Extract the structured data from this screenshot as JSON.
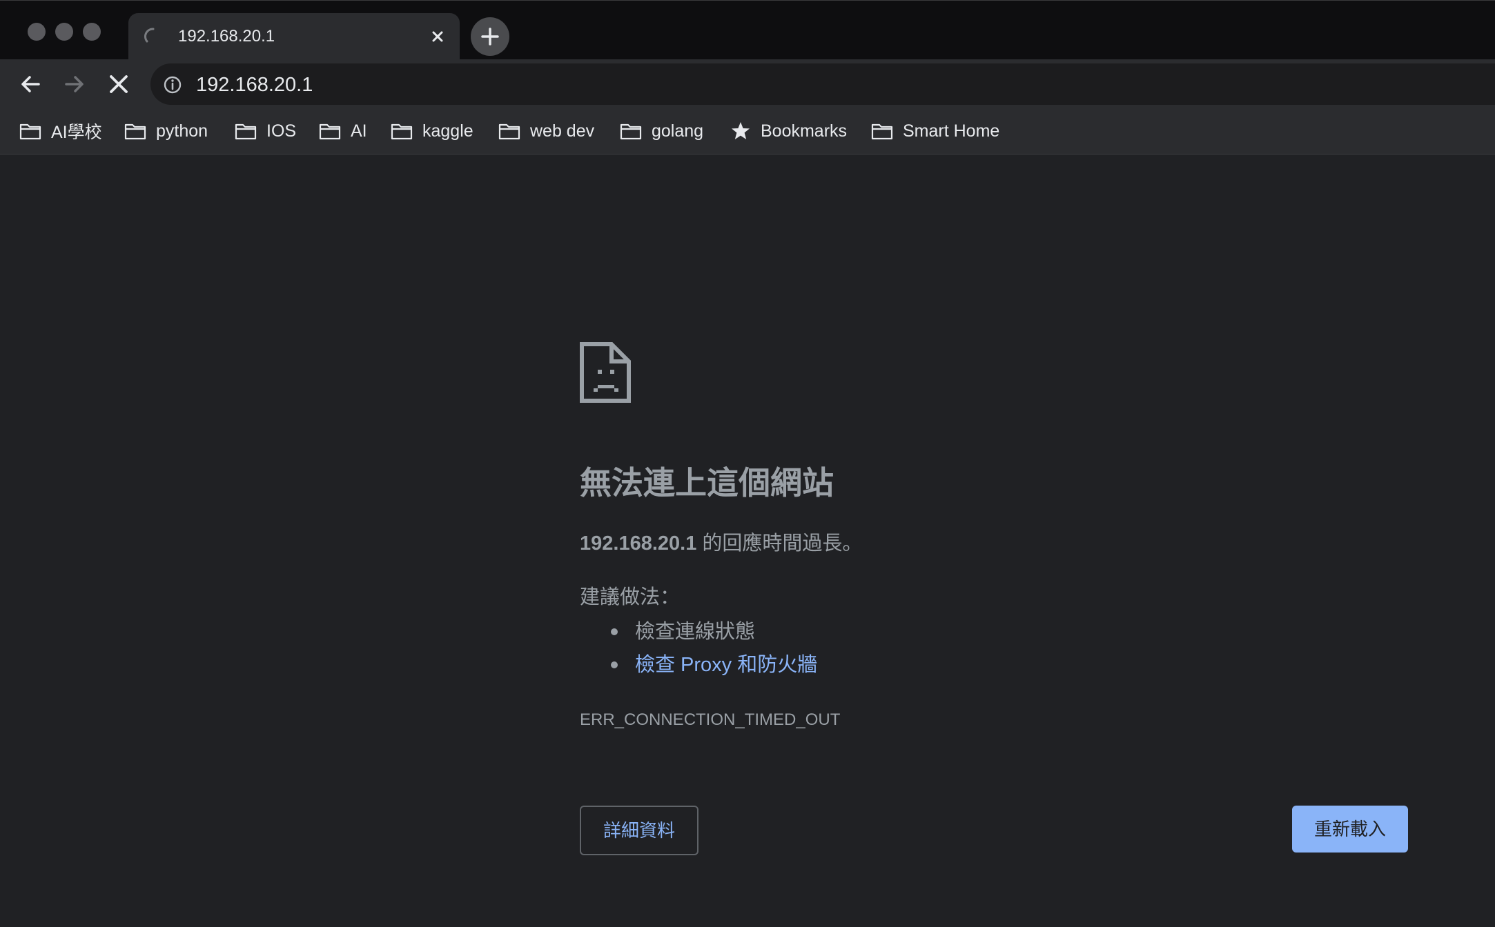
{
  "window": {
    "traffic_lights": [
      "close",
      "minimize",
      "maximize"
    ]
  },
  "tab": {
    "title": "192.168.20.1",
    "status_icon": "loading-spinner-icon",
    "close_icon": "close-icon"
  },
  "new_tab": {
    "icon": "plus-icon"
  },
  "toolbar": {
    "back_icon": "arrow-left-icon",
    "forward_icon": "arrow-right-icon",
    "stop_icon": "close-icon",
    "omnibox": {
      "info_icon": "info-icon",
      "url": "192.168.20.1"
    }
  },
  "bookmarks": [
    {
      "label": "AI學校",
      "icon": "folder-icon"
    },
    {
      "label": "python",
      "icon": "folder-icon"
    },
    {
      "label": "IOS",
      "icon": "folder-icon"
    },
    {
      "label": "AI",
      "icon": "folder-icon"
    },
    {
      "label": "kaggle",
      "icon": "folder-icon"
    },
    {
      "label": "web dev",
      "icon": "folder-icon"
    },
    {
      "label": "golang",
      "icon": "folder-icon"
    },
    {
      "label": "Bookmarks",
      "icon": "star-icon"
    },
    {
      "label": "Smart Home",
      "icon": "folder-icon"
    }
  ],
  "error_page": {
    "icon": "sad-document-icon",
    "heading": "無法連上這個網站",
    "summary_host": "192.168.20.1",
    "summary_text": " 的回應時間過長。",
    "suggestions_label": "建議做法：",
    "suggestions": [
      {
        "text": "檢查連線狀態",
        "is_link": false
      },
      {
        "text": "檢查 Proxy 和防火牆",
        "is_link": true
      }
    ],
    "error_code": "ERR_CONNECTION_TIMED_OUT",
    "details_button": "詳細資料",
    "reload_button": "重新載入"
  },
  "colors": {
    "background": "#202124",
    "chrome": "#2b2c2f",
    "text_secondary": "#9aa0a6",
    "link": "#8ab4f8",
    "button_primary": "#8ab4f8"
  }
}
